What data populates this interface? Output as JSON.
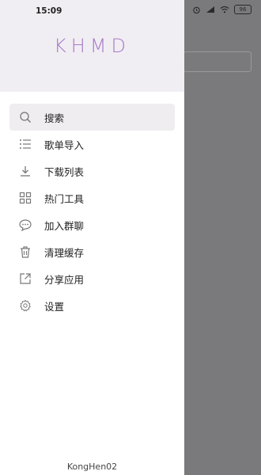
{
  "status": {
    "time": "15:09",
    "battery": "96"
  },
  "drawer": {
    "brand": "KHMD",
    "footer": "KongHen02",
    "items": [
      {
        "label": "搜索",
        "icon": "search-icon"
      },
      {
        "label": "歌单导入",
        "icon": "list-icon"
      },
      {
        "label": "下载列表",
        "icon": "download-icon"
      },
      {
        "label": "热门工具",
        "icon": "grid-icon"
      },
      {
        "label": "加入群聊",
        "icon": "chat-bubble-icon"
      },
      {
        "label": "清理缓存",
        "icon": "trash-icon"
      },
      {
        "label": "分享应用",
        "icon": "share-icon"
      },
      {
        "label": "设置",
        "icon": "gear-icon"
      }
    ]
  },
  "colors": {
    "brand": "#a57ac7",
    "header_bg": "#f1eef3",
    "active_bg": "#efedf0",
    "scrim": "#7a7a7c"
  }
}
